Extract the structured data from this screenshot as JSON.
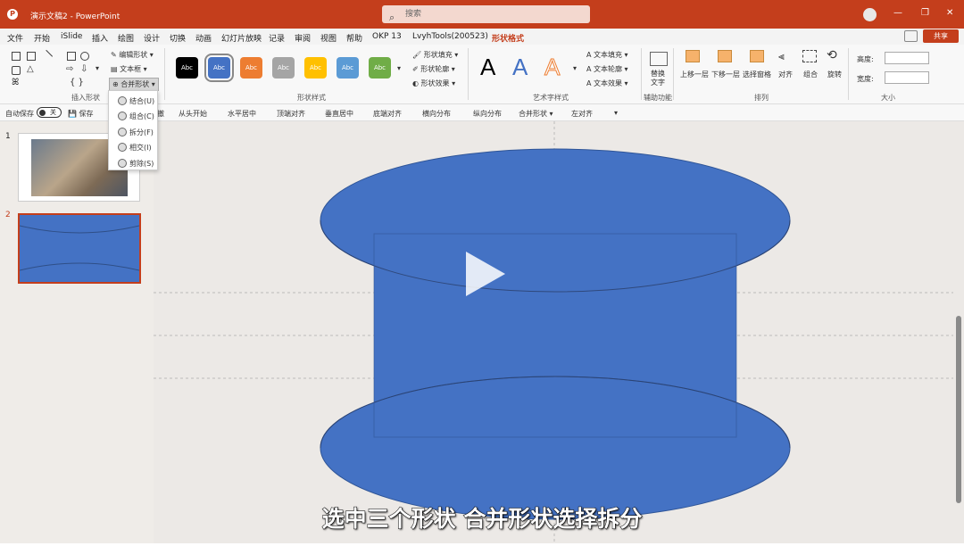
{
  "titlebar": {
    "doc_title": "演示文稿2  -  PowerPoint",
    "search_placeholder": "搜索",
    "app_logo": "P"
  },
  "tabs": [
    "文件",
    "开始",
    "iSlide",
    "插入",
    "绘图",
    "设计",
    "切换",
    "动画",
    "幻灯片放映",
    "记录",
    "审阅",
    "视图",
    "帮助",
    "OKP 13",
    "LvyhTools(200523)",
    "形状格式"
  ],
  "active_tab": "形状格式",
  "share_label": "共享",
  "ribbon": {
    "insert_shape": {
      "label": "插入形状",
      "edit_shape": "编辑形状",
      "text_box": "文本框",
      "merge_shapes": "合并形状"
    },
    "shape_styles": {
      "label": "形状样式",
      "swatches": [
        {
          "text": "Abc",
          "color": "#000000"
        },
        {
          "text": "Abc",
          "color": "#4472c4"
        },
        {
          "text": "Abc",
          "color": "#ed7d31"
        },
        {
          "text": "Abc",
          "color": "#a5a5a5"
        },
        {
          "text": "Abc",
          "color": "#ffc000"
        },
        {
          "text": "Abc",
          "color": "#5b9bd5"
        },
        {
          "text": "Abc",
          "color": "#70ad47"
        }
      ],
      "fill": "形状填充",
      "outline": "形状轮廓",
      "effects": "形状效果"
    },
    "wordart": {
      "label": "艺术字样式",
      "letter": "A",
      "text_fill": "文本填充",
      "text_outline": "文本轮廓",
      "text_effects": "文本效果"
    },
    "accessibility": {
      "label": "辅助功能",
      "alt_text_1": "替换",
      "alt_text_2": "文字"
    },
    "arrange": {
      "label": "排列",
      "forward": "上移一层",
      "backward": "下移一层",
      "pane": "选择窗格",
      "align": "对齐",
      "group": "组合",
      "rotate": "旋转"
    },
    "size": {
      "label": "大小",
      "height": "高度:",
      "width": "宽度:"
    }
  },
  "qat": {
    "autosave": "自动保存",
    "toggle": "关",
    "save": "保存",
    "items": [
      "撤",
      "从头开始",
      "水平居中",
      "顶端对齐",
      "垂直居中",
      "底端对齐",
      "横向分布",
      "纵向分布",
      "合并形状",
      "左对齐"
    ]
  },
  "merge_menu": [
    "结合(U)",
    "组合(C)",
    "拆分(F)",
    "相交(I)",
    "剪除(S)"
  ],
  "slides": [
    "1",
    "2"
  ],
  "subtitle": "选中三个形状 合并形状选择拆分"
}
